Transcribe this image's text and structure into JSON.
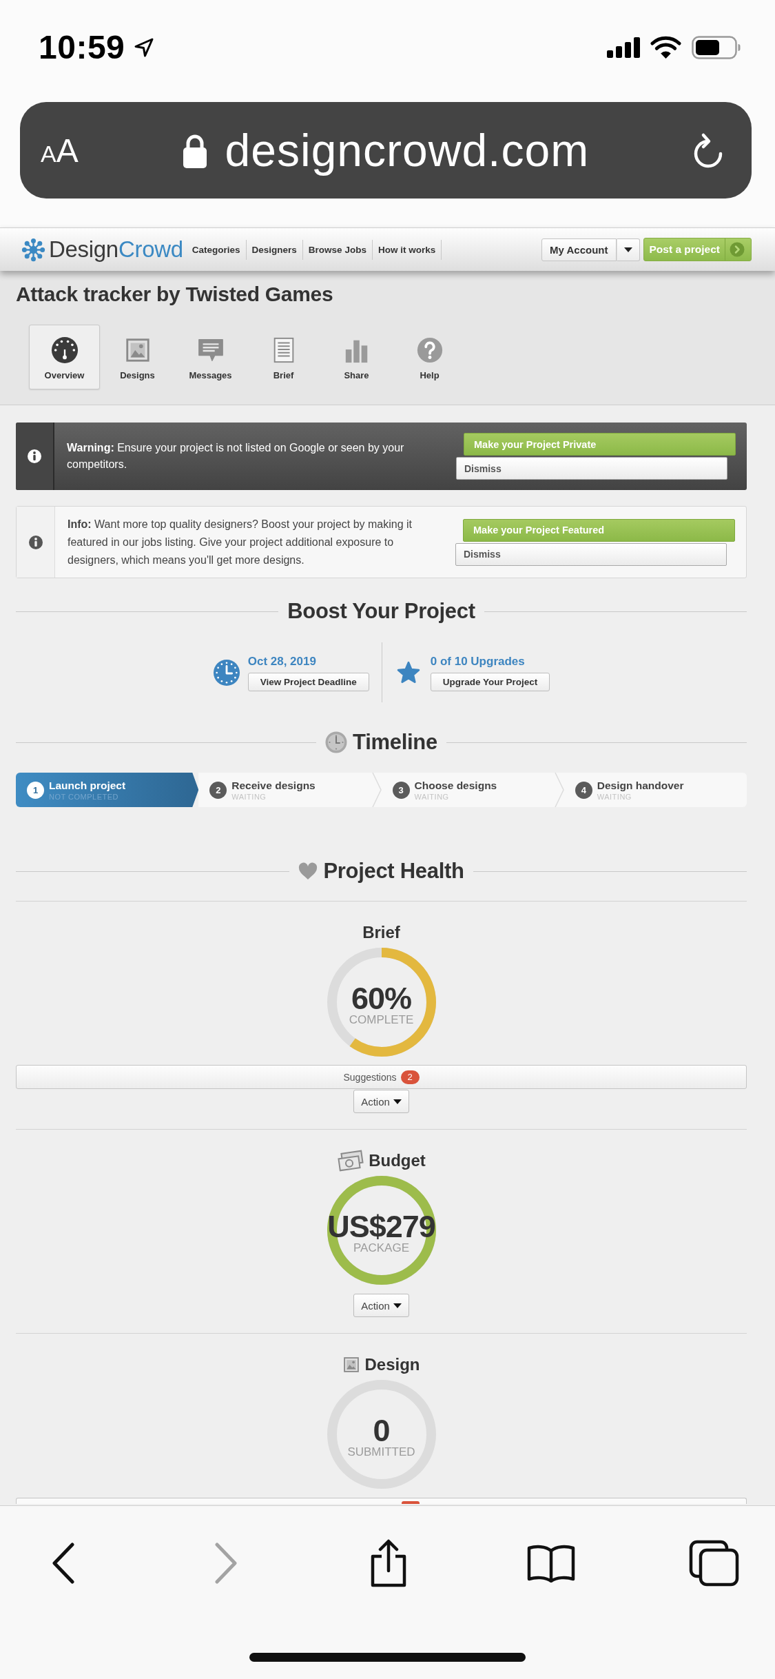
{
  "status_bar": {
    "time": "10:59"
  },
  "browser": {
    "text_size_button": "AA",
    "url": "designcrowd.com"
  },
  "site_header": {
    "logo": [
      "Design",
      "Crowd"
    ],
    "nav": [
      "Categories",
      "Designers",
      "Browse Jobs",
      "How it works"
    ],
    "account_button": "My Account",
    "post_button": "Post a project"
  },
  "project": {
    "title": "Attack tracker by Twisted Games",
    "tabs": [
      {
        "kind": "overview",
        "label": "Overview",
        "selected": true
      },
      {
        "kind": "designs",
        "label": "Designs",
        "selected": false
      },
      {
        "kind": "messages",
        "label": "Messages",
        "selected": false
      },
      {
        "kind": "brief",
        "label": "Brief",
        "selected": false
      },
      {
        "kind": "share",
        "label": "Share",
        "selected": false
      },
      {
        "kind": "help",
        "label": "Help",
        "selected": false
      }
    ]
  },
  "alerts": [
    {
      "kind": "warning",
      "text": "**Warning:** Ensure your project is not listed on Google or seen by your competitors.",
      "action_button": "Make your Project Private",
      "dismiss_button": "Dismiss"
    },
    {
      "kind": "info",
      "text": "**Info:** Want more top quality designers? Boost your project by making it featured in our jobs listing. Give your project additional exposure to designers, which means you'll get more designs.",
      "action_button": "Make your Project Featured",
      "dismiss_button": "Dismiss"
    }
  ],
  "boost": {
    "title": "Boost Your Project",
    "items": [
      {
        "kind": "deadline",
        "value": "Oct 28, 2019",
        "button": "View Project Deadline"
      },
      {
        "kind": "upgrades",
        "value": "0 of 10 Upgrades",
        "button": "Upgrade Your Project"
      }
    ]
  },
  "timeline": {
    "title": "Timeline",
    "steps": [
      {
        "number": "1",
        "title": "Launch project",
        "status": "NOT COMPLETED",
        "active": true
      },
      {
        "number": "2",
        "title": "Receive designs",
        "status": "WAITING",
        "active": false
      },
      {
        "number": "3",
        "title": "Choose designs",
        "status": "WAITING",
        "active": false
      },
      {
        "number": "4",
        "title": "Design handover",
        "status": "WAITING",
        "active": false
      }
    ]
  },
  "health": {
    "title": "Project Health",
    "items": [
      {
        "kind": "brief",
        "title": "Brief",
        "value": "60%",
        "caption": "COMPLETE",
        "level": 0.6,
        "color": "#e3b83f",
        "suggestions": {
          "label": "Suggestions",
          "count": "2"
        },
        "action": "Action"
      },
      {
        "kind": "budget",
        "title": "Budget",
        "value": "US$279",
        "caption": "PACKAGE",
        "level": 1,
        "color": "#9dbc4b",
        "action": "Action"
      },
      {
        "kind": "design",
        "title": "Design",
        "value": "0",
        "caption": "SUBMITTED",
        "level": 0,
        "suggestions": {
          "cut_off": true
        }
      }
    ]
  },
  "toolbar": [
    {
      "kind": "back",
      "disabled": false
    },
    {
      "kind": "forward",
      "disabled": true
    },
    {
      "kind": "share",
      "disabled": false
    },
    {
      "kind": "bookmarks",
      "disabled": false
    },
    {
      "kind": "tabs",
      "disabled": false
    }
  ]
}
